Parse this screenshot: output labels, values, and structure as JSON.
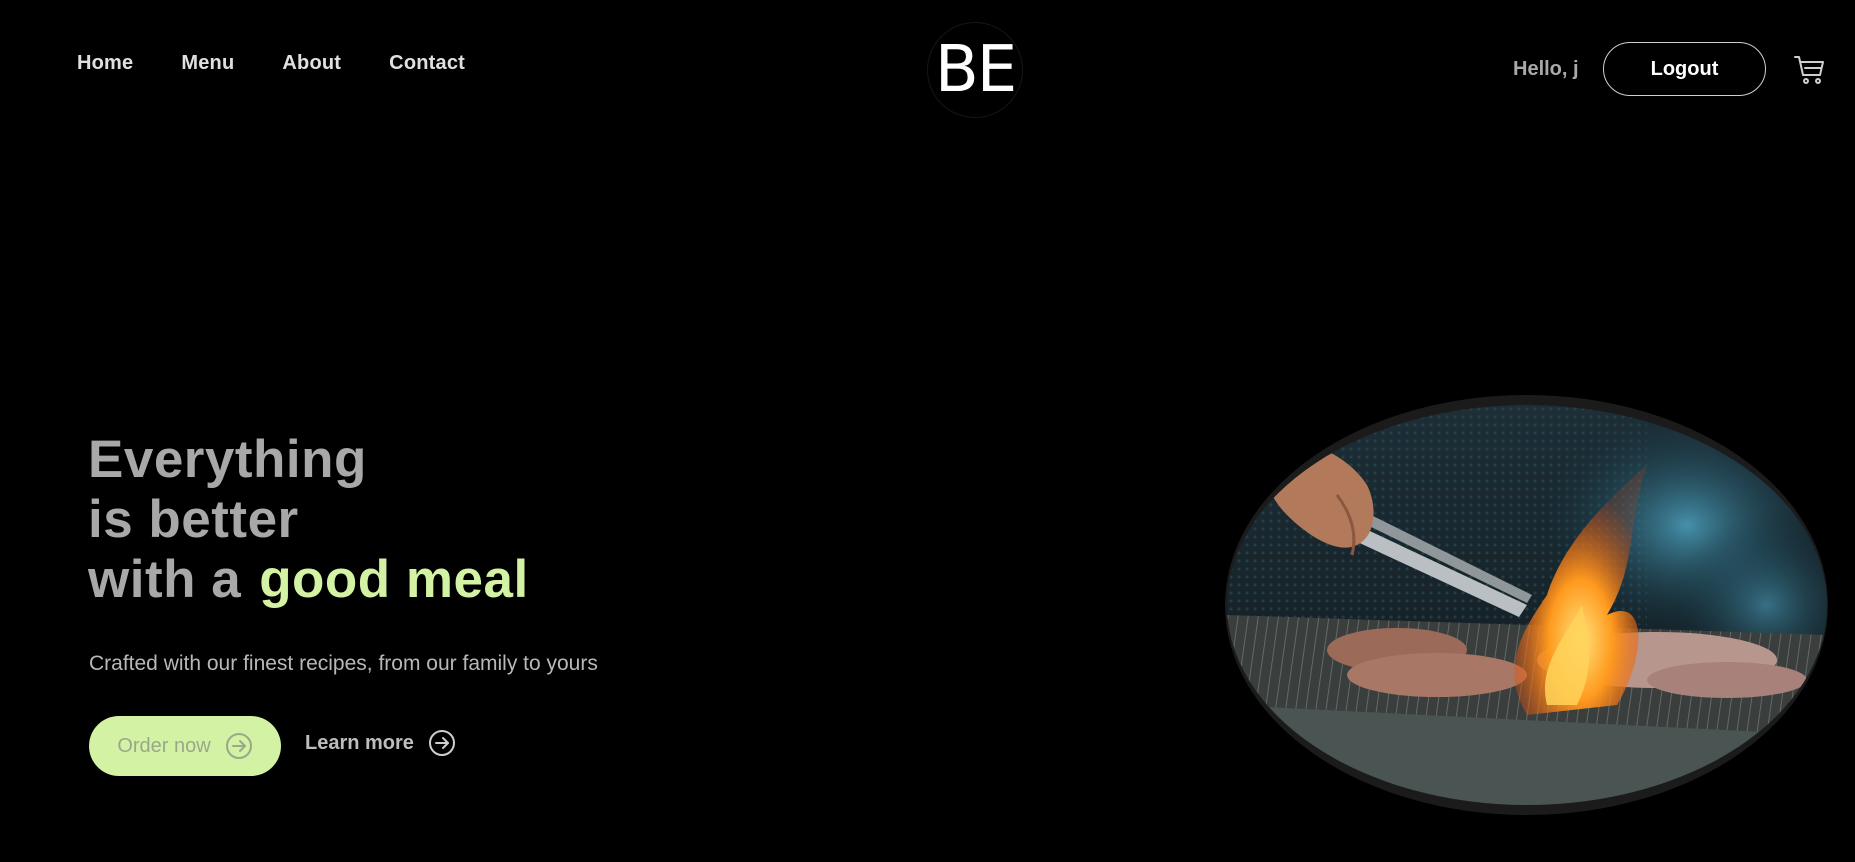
{
  "nav": {
    "items": [
      {
        "label": "Home"
      },
      {
        "label": "Menu"
      },
      {
        "label": "About"
      },
      {
        "label": "Contact"
      }
    ]
  },
  "logo": {
    "text": "BE"
  },
  "user": {
    "greeting": "Hello, j",
    "logout_label": "Logout",
    "cart_icon": "cart-icon"
  },
  "hero": {
    "line1": "Everything",
    "line2": "is better",
    "line3_prefix": "with a",
    "line3_accent": "good meal",
    "subtitle": "Crafted with our finest recipes, from our family to yours",
    "order_label": "Order now",
    "learn_label": "Learn more",
    "accent_color": "#d4f2a4",
    "image_alt": "Meat grilling over flames with tongs"
  }
}
